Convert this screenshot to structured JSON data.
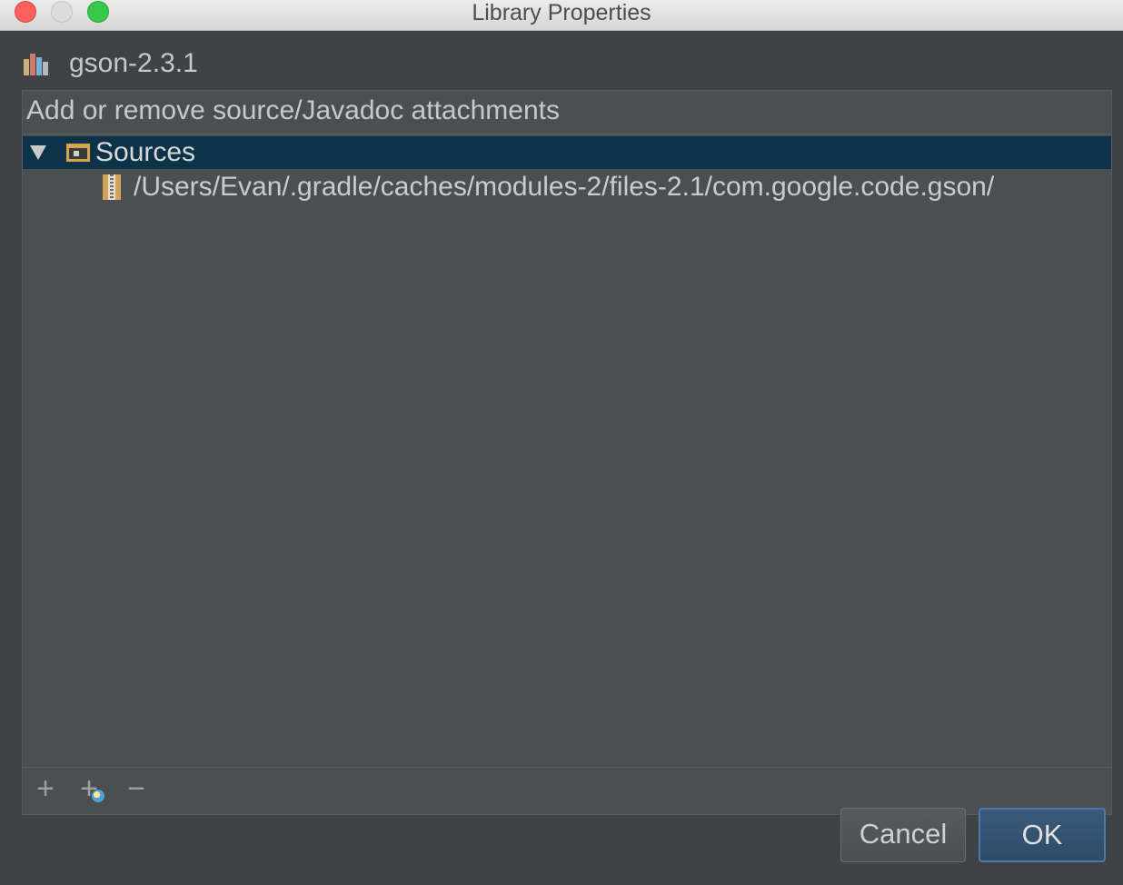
{
  "window": {
    "title": "Library Properties"
  },
  "library": {
    "name": "gson-2.3.1",
    "icon": "library-icon"
  },
  "attachments": {
    "header": "Add or remove source/Javadoc attachments",
    "tree": {
      "sources_label": "Sources",
      "sources_path": "/Users/Evan/.gradle/caches/modules-2/files-2.1/com.google.code.gson/"
    },
    "toolbar": {
      "add_symbol": "+",
      "add_url_symbol": "+",
      "remove_symbol": "−"
    }
  },
  "buttons": {
    "cancel": "Cancel",
    "ok": "OK"
  },
  "colors": {
    "selection": "#0d3349",
    "folder": "#d6a54e",
    "ok_button": "#2e4a68"
  }
}
